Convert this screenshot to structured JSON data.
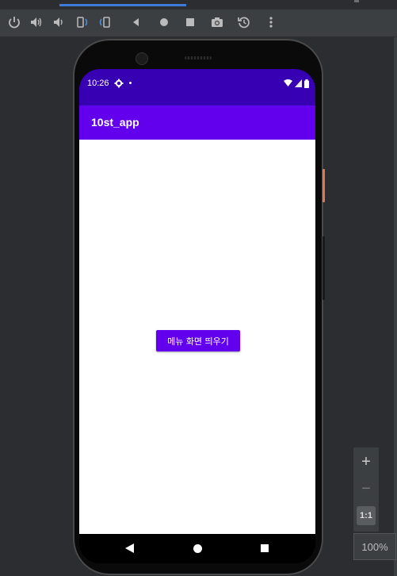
{
  "toolbar": {
    "buttons": [
      {
        "name": "power-icon"
      },
      {
        "name": "volume-up-icon"
      },
      {
        "name": "volume-down-icon"
      },
      {
        "name": "rotate-left-icon"
      },
      {
        "name": "rotate-right-icon"
      },
      {
        "name": "back-icon"
      },
      {
        "name": "home-icon"
      },
      {
        "name": "overview-icon"
      },
      {
        "name": "camera-icon"
      },
      {
        "name": "snapshot-icon"
      },
      {
        "name": "more-icon"
      }
    ]
  },
  "status_bar": {
    "time": "10:26"
  },
  "app_bar": {
    "title": "10st_app"
  },
  "main": {
    "menu_button_label": "메뉴 화면 띄우기"
  },
  "zoom": {
    "plus": "+",
    "minus": "−",
    "fit": "1:1",
    "level": "100%"
  },
  "colors": {
    "status_bar": "#3700b3",
    "app_bar": "#6200ee",
    "button": "#6200ee",
    "accent_blue": "#3d7bd6"
  }
}
